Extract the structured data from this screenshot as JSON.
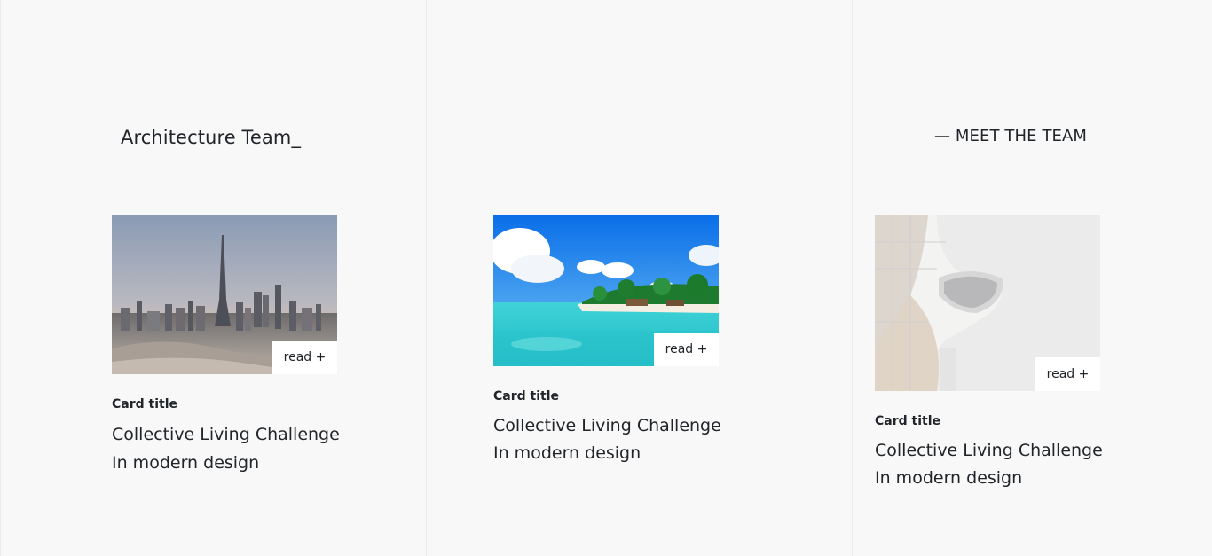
{
  "heading": "Architecture Team_",
  "meet_label": "— MEET THE TEAM",
  "cards": [
    {
      "image": "city-skyline-image",
      "button": "read +",
      "title": "Card title",
      "text_line1": "Collective Living Challenge",
      "text_line2": "In modern design"
    },
    {
      "image": "tropical-beach-image",
      "button": "read +",
      "title": "Card title",
      "text_line1": "Collective Living Challenge",
      "text_line2": "In modern design"
    },
    {
      "image": "white-architecture-image",
      "button": "read +",
      "title": "Card title",
      "text_line1": "Collective Living Challenge",
      "text_line2": "In modern design"
    }
  ]
}
